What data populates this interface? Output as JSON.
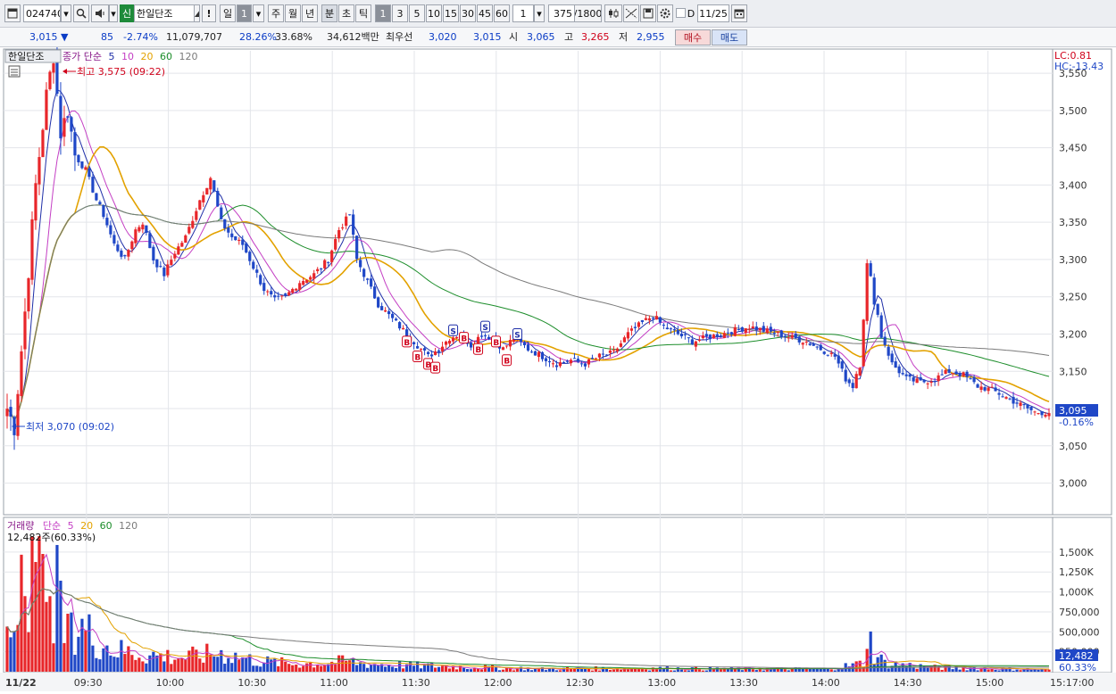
{
  "toolbar": {
    "code": "024740",
    "badge": "신",
    "name": "한일단조",
    "alert_label": "!",
    "period_day": "일",
    "period_num": "1",
    "period_week": "주",
    "period_month": "월",
    "period_year": "년",
    "period_min": "분",
    "period_sec": "초",
    "period_tick": "틱",
    "intervals": [
      "1",
      "3",
      "5",
      "10",
      "15",
      "30",
      "45",
      "60"
    ],
    "interval_value": "1",
    "count_value": "375",
    "count_total": "/1800",
    "d_label": "D",
    "date_value": "11/25"
  },
  "quote": {
    "price": "3,015",
    "change": "85",
    "change_pct": "-2.74%",
    "volume": "11,079,707",
    "vol_ratio": "28.26%",
    "turnover_ratio": "33.68%",
    "amount": "34,612백만",
    "priority_label": "최우선",
    "ask": "3,020",
    "bid": "3,015",
    "open_label": "시",
    "open": "3,065",
    "high_label": "고",
    "high": "3,265",
    "low_label": "저",
    "low": "2,955",
    "buy_label": "매수",
    "sell_label": "매도"
  },
  "price_panel": {
    "stock_label": "한일단조",
    "legend_prefix": "종가 단순",
    "ma_labels": [
      "5",
      "10",
      "20",
      "60",
      "120"
    ],
    "lc_label": "LC:0.81",
    "hc_label": "HC:-13.43",
    "high_annotation": "최고 3,575 (09:22)",
    "low_annotation": "최저 3,070 (09:02)",
    "current_price_box": "3,095",
    "current_change_pct": "-0.16%",
    "signal_buy": "B",
    "signal_sell": "S"
  },
  "volume_panel": {
    "legend_prefix": "거래량",
    "legend_method": "단순",
    "ma_labels": [
      "5",
      "20",
      "60",
      "120"
    ],
    "current_label": "12,482주(60.33%)",
    "current_box": "12,482",
    "current_pct_box": "60.33%"
  },
  "colors": {
    "up": "#e8262a",
    "down": "#1f47c7",
    "ma5": "#1f2fa8",
    "ma10": "#c43fc4",
    "ma20": "#e3a200",
    "ma60": "#1c8d2a",
    "ma120": "#7a7a7a"
  },
  "chart_data": {
    "type": "candlestick",
    "x_ticks": [
      "11/22",
      "09:30",
      "10:00",
      "10:30",
      "11:00",
      "11:30",
      "12:00",
      "12:30",
      "13:00",
      "13:30",
      "14:00",
      "14:30",
      "15:00",
      "15:17:00"
    ],
    "y_ticks": [
      "3,550",
      "3,500",
      "3,450",
      "3,400",
      "3,350",
      "3,300",
      "3,250",
      "3,200",
      "3,150",
      "3,100",
      "3,050",
      "3,000"
    ],
    "volume_ticks": [
      "1,500K",
      "1,250K",
      "1,000K",
      "750,000",
      "500,000",
      "250,000"
    ],
    "ylim": [
      2960,
      3580
    ],
    "volume_ylim": [
      0,
      1700000
    ],
    "price_path": [
      [
        0,
        3100
      ],
      [
        2,
        3075
      ],
      [
        5,
        3230
      ],
      [
        8,
        3400
      ],
      [
        11,
        3520
      ],
      [
        13,
        3575
      ],
      [
        15,
        3470
      ],
      [
        17,
        3500
      ],
      [
        19,
        3440
      ],
      [
        22,
        3420
      ],
      [
        25,
        3380
      ],
      [
        27,
        3360
      ],
      [
        30,
        3320
      ],
      [
        33,
        3300
      ],
      [
        36,
        3340
      ],
      [
        38,
        3350
      ],
      [
        41,
        3300
      ],
      [
        44,
        3280
      ],
      [
        47,
        3310
      ],
      [
        50,
        3330
      ],
      [
        54,
        3380
      ],
      [
        57,
        3410
      ],
      [
        60,
        3350
      ],
      [
        63,
        3330
      ],
      [
        66,
        3320
      ],
      [
        69,
        3290
      ],
      [
        72,
        3260
      ],
      [
        75,
        3245
      ],
      [
        78,
        3250
      ],
      [
        82,
        3270
      ],
      [
        86,
        3280
      ],
      [
        90,
        3300
      ],
      [
        93,
        3340
      ],
      [
        96,
        3360
      ],
      [
        98,
        3300
      ],
      [
        101,
        3270
      ],
      [
        104,
        3240
      ],
      [
        108,
        3220
      ],
      [
        112,
        3200
      ],
      [
        115,
        3185
      ],
      [
        118,
        3170
      ],
      [
        121,
        3180
      ],
      [
        124,
        3195
      ],
      [
        127,
        3200
      ],
      [
        130,
        3185
      ],
      [
        133,
        3200
      ],
      [
        136,
        3195
      ],
      [
        139,
        3180
      ],
      [
        142,
        3195
      ],
      [
        146,
        3180
      ],
      [
        150,
        3170
      ],
      [
        154,
        3160
      ],
      [
        158,
        3165
      ],
      [
        162,
        3160
      ],
      [
        166,
        3170
      ],
      [
        170,
        3175
      ],
      [
        174,
        3200
      ],
      [
        178,
        3215
      ],
      [
        181,
        3225
      ],
      [
        184,
        3210
      ],
      [
        188,
        3200
      ],
      [
        192,
        3190
      ],
      [
        196,
        3195
      ],
      [
        200,
        3200
      ],
      [
        204,
        3205
      ],
      [
        208,
        3210
      ],
      [
        212,
        3205
      ],
      [
        216,
        3200
      ],
      [
        220,
        3195
      ],
      [
        224,
        3190
      ],
      [
        228,
        3180
      ],
      [
        232,
        3170
      ],
      [
        235,
        3140
      ],
      [
        237,
        3130
      ],
      [
        239,
        3165
      ],
      [
        241,
        3290
      ],
      [
        243,
        3250
      ],
      [
        245,
        3200
      ],
      [
        248,
        3160
      ],
      [
        252,
        3140
      ],
      [
        256,
        3135
      ],
      [
        260,
        3140
      ],
      [
        264,
        3150
      ],
      [
        268,
        3145
      ],
      [
        272,
        3130
      ],
      [
        276,
        3125
      ],
      [
        280,
        3115
      ],
      [
        284,
        3105
      ],
      [
        288,
        3095
      ],
      [
        292,
        3095
      ]
    ],
    "volume_profile": [
      [
        0,
        520000
      ],
      [
        5,
        1150000
      ],
      [
        10,
        1300000
      ],
      [
        15,
        900000
      ],
      [
        20,
        650000
      ],
      [
        25,
        450000
      ],
      [
        30,
        300000
      ],
      [
        40,
        230000
      ],
      [
        50,
        200000
      ],
      [
        60,
        260000
      ],
      [
        70,
        150000
      ],
      [
        80,
        110000
      ],
      [
        90,
        120000
      ],
      [
        95,
        150000
      ],
      [
        100,
        110000
      ],
      [
        120,
        80000
      ],
      [
        150,
        40000
      ],
      [
        180,
        50000
      ],
      [
        200,
        40000
      ],
      [
        230,
        40000
      ],
      [
        240,
        120000
      ],
      [
        241,
        550000
      ],
      [
        243,
        260000
      ],
      [
        246,
        120000
      ],
      [
        260,
        60000
      ],
      [
        292,
        30000
      ]
    ],
    "signals": [
      {
        "t": 115,
        "type": "B",
        "level": 3170
      },
      {
        "t": 118,
        "type": "B",
        "level": 3160
      },
      {
        "t": 120,
        "type": "B",
        "level": 3155
      },
      {
        "t": 112,
        "type": "B",
        "level": 3190
      },
      {
        "t": 125,
        "type": "S",
        "level": 3205
      },
      {
        "t": 128,
        "type": "B",
        "level": 3195
      },
      {
        "t": 132,
        "type": "B",
        "level": 3180
      },
      {
        "t": 134,
        "type": "S",
        "level": 3210
      },
      {
        "t": 137,
        "type": "B",
        "level": 3190
      },
      {
        "t": 140,
        "type": "B",
        "level": 3165
      },
      {
        "t": 143,
        "type": "S",
        "level": 3200
      }
    ]
  }
}
